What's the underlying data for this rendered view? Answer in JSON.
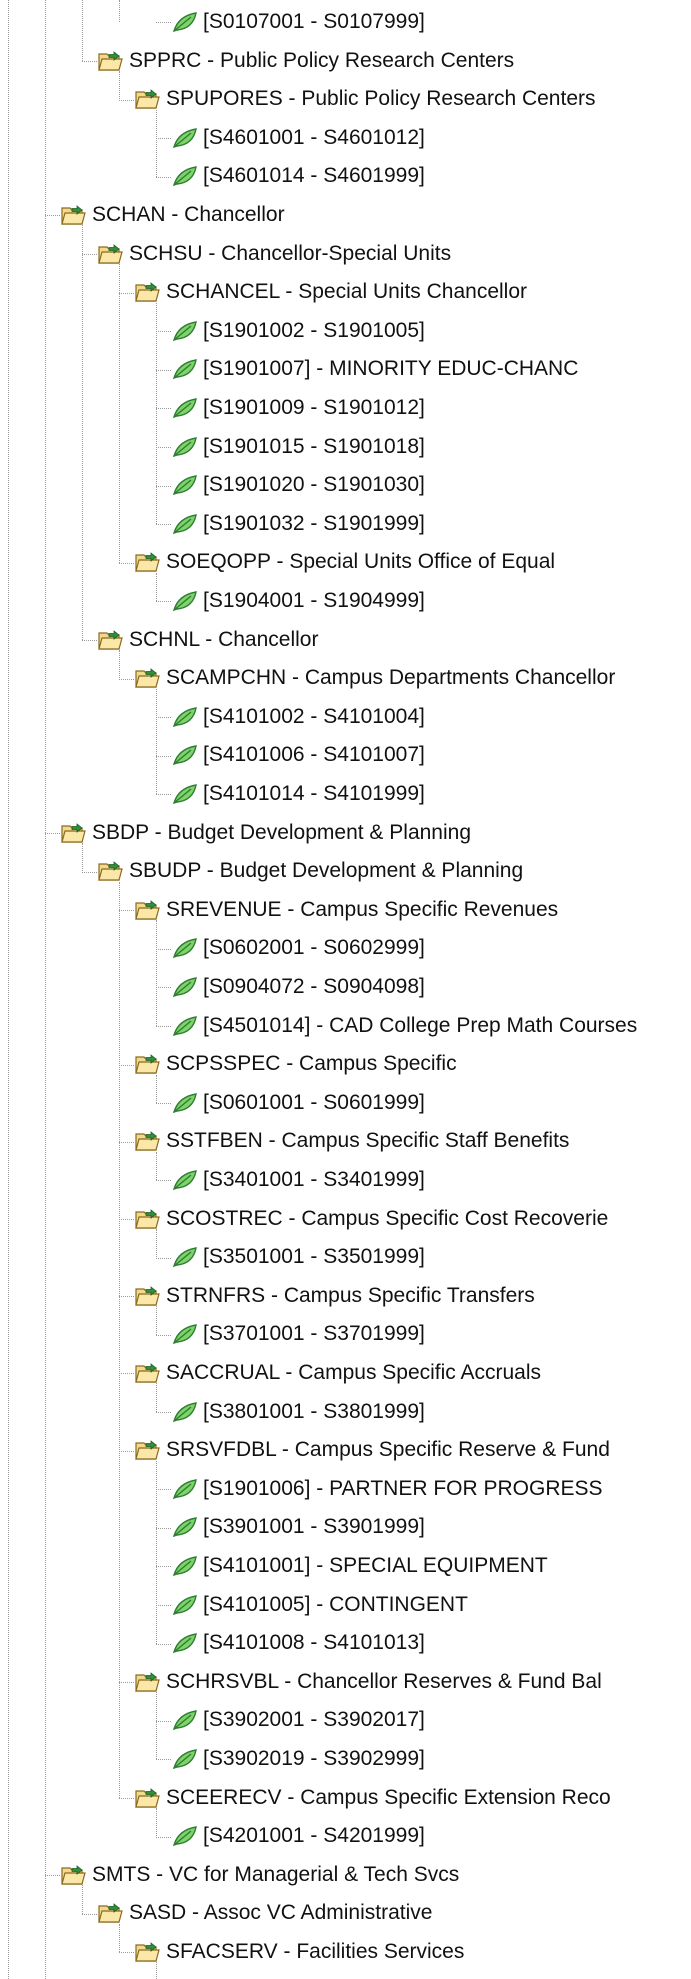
{
  "tree": {
    "nodes": [
      {
        "level": 4,
        "type": "range",
        "label": "[S0107001 - S0107999]"
      },
      {
        "level": 2,
        "type": "folder",
        "label": "SPPRC - Public Policy Research Centers"
      },
      {
        "level": 3,
        "type": "folder",
        "label": "SPUPORES - Public Policy Research Centers"
      },
      {
        "level": 4,
        "type": "range",
        "label": "[S4601001 - S4601012]"
      },
      {
        "level": 4,
        "type": "range",
        "label": "[S4601014 - S4601999]"
      },
      {
        "level": 1,
        "type": "folder",
        "label": "SCHAN - Chancellor"
      },
      {
        "level": 2,
        "type": "folder",
        "label": "SCHSU - Chancellor-Special Units"
      },
      {
        "level": 3,
        "type": "folder",
        "label": "SCHANCEL - Special Units Chancellor"
      },
      {
        "level": 4,
        "type": "range",
        "label": "[S1901002 - S1901005]"
      },
      {
        "level": 4,
        "type": "range",
        "label": "[S1901007] - MINORITY EDUC-CHANC"
      },
      {
        "level": 4,
        "type": "range",
        "label": "[S1901009 - S1901012]"
      },
      {
        "level": 4,
        "type": "range",
        "label": "[S1901015 - S1901018]"
      },
      {
        "level": 4,
        "type": "range",
        "label": "[S1901020 - S1901030]"
      },
      {
        "level": 4,
        "type": "range",
        "label": "[S1901032 - S1901999]"
      },
      {
        "level": 3,
        "type": "folder",
        "label": "SOEQOPP - Special Units Office of Equal"
      },
      {
        "level": 4,
        "type": "range",
        "label": "[S1904001 - S1904999]"
      },
      {
        "level": 2,
        "type": "folder",
        "label": "SCHNL - Chancellor"
      },
      {
        "level": 3,
        "type": "folder",
        "label": "SCAMPCHN - Campus Departments Chancellor"
      },
      {
        "level": 4,
        "type": "range",
        "label": "[S4101002 - S4101004]"
      },
      {
        "level": 4,
        "type": "range",
        "label": "[S4101006 - S4101007]"
      },
      {
        "level": 4,
        "type": "range",
        "label": "[S4101014 - S4101999]"
      },
      {
        "level": 1,
        "type": "folder",
        "label": "SBDP - Budget Development & Planning"
      },
      {
        "level": 2,
        "type": "folder",
        "label": "SBUDP - Budget Development & Planning"
      },
      {
        "level": 3,
        "type": "folder",
        "label": "SREVENUE - Campus Specific Revenues"
      },
      {
        "level": 4,
        "type": "range",
        "label": "[S0602001 - S0602999]"
      },
      {
        "level": 4,
        "type": "range",
        "label": "[S0904072 - S0904098]"
      },
      {
        "level": 4,
        "type": "range",
        "label": "[S4501014] - CAD College Prep Math Courses"
      },
      {
        "level": 3,
        "type": "folder",
        "label": "SCPSSPEC - Campus Specific"
      },
      {
        "level": 4,
        "type": "range",
        "label": "[S0601001 - S0601999]"
      },
      {
        "level": 3,
        "type": "folder",
        "label": "SSTFBEN - Campus Specific Staff Benefits"
      },
      {
        "level": 4,
        "type": "range",
        "label": "[S3401001 - S3401999]"
      },
      {
        "level": 3,
        "type": "folder",
        "label": "SCOSTREC - Campus Specific Cost Recoverie"
      },
      {
        "level": 4,
        "type": "range",
        "label": "[S3501001 - S3501999]"
      },
      {
        "level": 3,
        "type": "folder",
        "label": "STRNFRS - Campus Specific Transfers"
      },
      {
        "level": 4,
        "type": "range",
        "label": "[S3701001 - S3701999]"
      },
      {
        "level": 3,
        "type": "folder",
        "label": "SACCRUAL - Campus Specific Accruals"
      },
      {
        "level": 4,
        "type": "range",
        "label": "[S3801001 - S3801999]"
      },
      {
        "level": 3,
        "type": "folder",
        "label": "SRSVFDBL - Campus Specific Reserve & Fund"
      },
      {
        "level": 4,
        "type": "range",
        "label": "[S1901006] - PARTNER FOR PROGRESS"
      },
      {
        "level": 4,
        "type": "range",
        "label": "[S3901001 - S3901999]"
      },
      {
        "level": 4,
        "type": "range",
        "label": "[S4101001] - SPECIAL EQUIPMENT"
      },
      {
        "level": 4,
        "type": "range",
        "label": "[S4101005] - CONTINGENT"
      },
      {
        "level": 4,
        "type": "range",
        "label": "[S4101008 - S4101013]"
      },
      {
        "level": 3,
        "type": "folder",
        "label": "SCHRSVBL - Chancellor Reserves & Fund Bal"
      },
      {
        "level": 4,
        "type": "range",
        "label": "[S3902001 - S3902017]"
      },
      {
        "level": 4,
        "type": "range",
        "label": "[S3902019 - S3902999]"
      },
      {
        "level": 3,
        "type": "folder",
        "label": "SCEERECV - Campus Specific Extension Reco"
      },
      {
        "level": 4,
        "type": "range",
        "label": "[S4201001 - S4201999]"
      },
      {
        "level": 1,
        "type": "folder",
        "label": "SMTS - VC for Managerial & Tech Svcs"
      },
      {
        "level": 2,
        "type": "folder",
        "label": "SASD - Assoc VC Administrative"
      },
      {
        "level": 3,
        "type": "folder",
        "label": "SFACSERV - Facilities Services"
      }
    ]
  }
}
